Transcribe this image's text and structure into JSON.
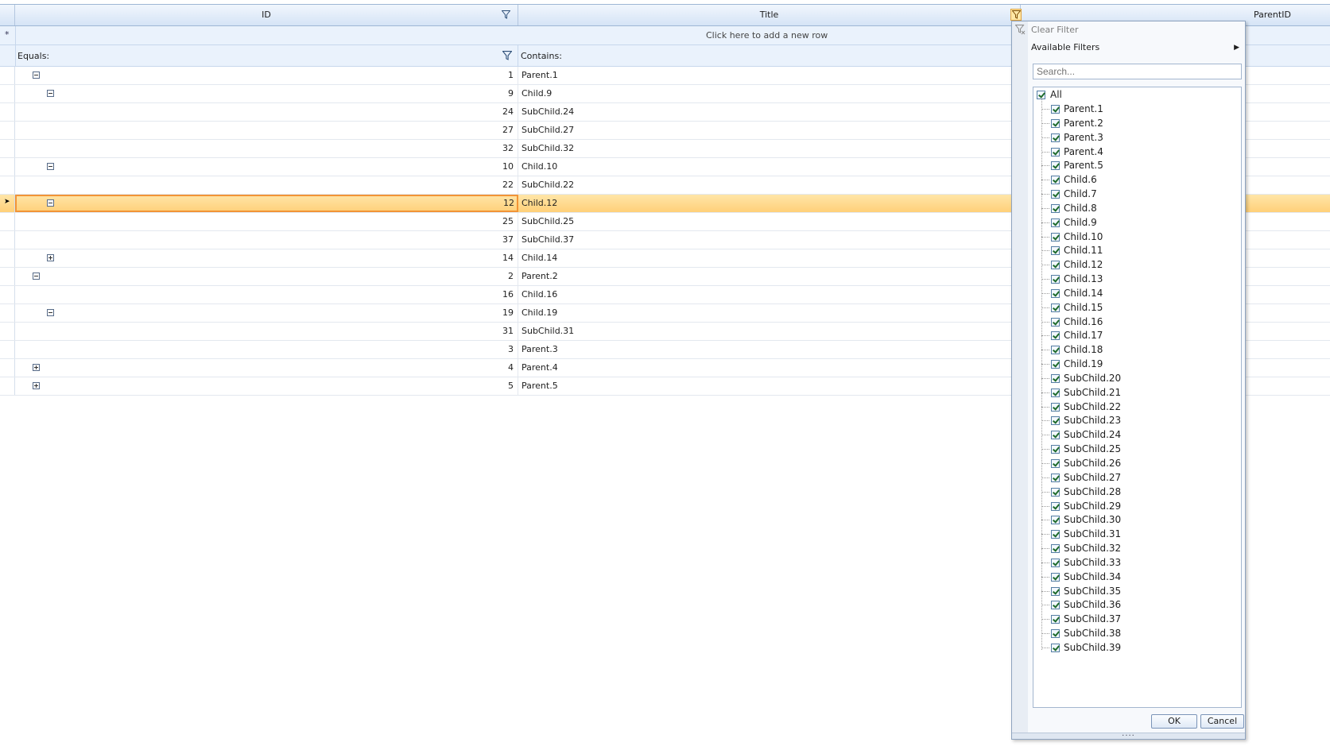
{
  "header": {
    "columns": [
      {
        "label": "ID"
      },
      {
        "label": "Title"
      },
      {
        "label": "ParentID"
      }
    ]
  },
  "new_row": {
    "label": "Click here to add a new row",
    "marker": "*"
  },
  "filter_row": {
    "id_operator": "Equals:",
    "title_operator": "Contains:"
  },
  "rows": [
    {
      "id": "1",
      "title": "Parent.1",
      "expander": "minus",
      "level": 0
    },
    {
      "id": "9",
      "title": "Child.9",
      "expander": "minus",
      "level": 1
    },
    {
      "id": "24",
      "title": "SubChild.24",
      "expander": "",
      "level": 2
    },
    {
      "id": "27",
      "title": "SubChild.27",
      "expander": "",
      "level": 2
    },
    {
      "id": "32",
      "title": "SubChild.32",
      "expander": "",
      "level": 2
    },
    {
      "id": "10",
      "title": "Child.10",
      "expander": "minus",
      "level": 1
    },
    {
      "id": "22",
      "title": "SubChild.22",
      "expander": "",
      "level": 2
    },
    {
      "id": "12",
      "title": "Child.12",
      "expander": "minus",
      "level": 1,
      "selected": true
    },
    {
      "id": "25",
      "title": "SubChild.25",
      "expander": "",
      "level": 2
    },
    {
      "id": "37",
      "title": "SubChild.37",
      "expander": "",
      "level": 2
    },
    {
      "id": "14",
      "title": "Child.14",
      "expander": "plus",
      "level": 1
    },
    {
      "id": "2",
      "title": "Parent.2",
      "expander": "minus",
      "level": 0
    },
    {
      "id": "16",
      "title": "Child.16",
      "expander": "",
      "level": 1
    },
    {
      "id": "19",
      "title": "Child.19",
      "expander": "minus",
      "level": 1
    },
    {
      "id": "31",
      "title": "SubChild.31",
      "expander": "",
      "level": 2
    },
    {
      "id": "3",
      "title": "Parent.3",
      "expander": "",
      "level": 0
    },
    {
      "id": "4",
      "title": "Parent.4",
      "expander": "plus",
      "level": 0
    },
    {
      "id": "5",
      "title": "Parent.5",
      "expander": "plus",
      "level": 0
    }
  ],
  "filter_popup": {
    "clear_filter": "Clear Filter",
    "available_filters": "Available Filters",
    "search_placeholder": "Search...",
    "all_label": "All",
    "values": [
      "Parent.1",
      "Parent.2",
      "Parent.3",
      "Parent.4",
      "Parent.5",
      "Child.6",
      "Child.7",
      "Child.8",
      "Child.9",
      "Child.10",
      "Child.11",
      "Child.12",
      "Child.13",
      "Child.14",
      "Child.15",
      "Child.16",
      "Child.17",
      "Child.18",
      "Child.19",
      "SubChild.20",
      "SubChild.21",
      "SubChild.22",
      "SubChild.23",
      "SubChild.24",
      "SubChild.25",
      "SubChild.26",
      "SubChild.27",
      "SubChild.28",
      "SubChild.29",
      "SubChild.30",
      "SubChild.31",
      "SubChild.32",
      "SubChild.33",
      "SubChild.34",
      "SubChild.35",
      "SubChild.36",
      "SubChild.37",
      "SubChild.38",
      "SubChild.39"
    ],
    "ok_label": "OK",
    "cancel_label": "Cancel",
    "grip": "...."
  },
  "colors": {
    "selected_row": "#ffd079",
    "selected_border": "#f29436",
    "header": "#d5e4f6"
  }
}
